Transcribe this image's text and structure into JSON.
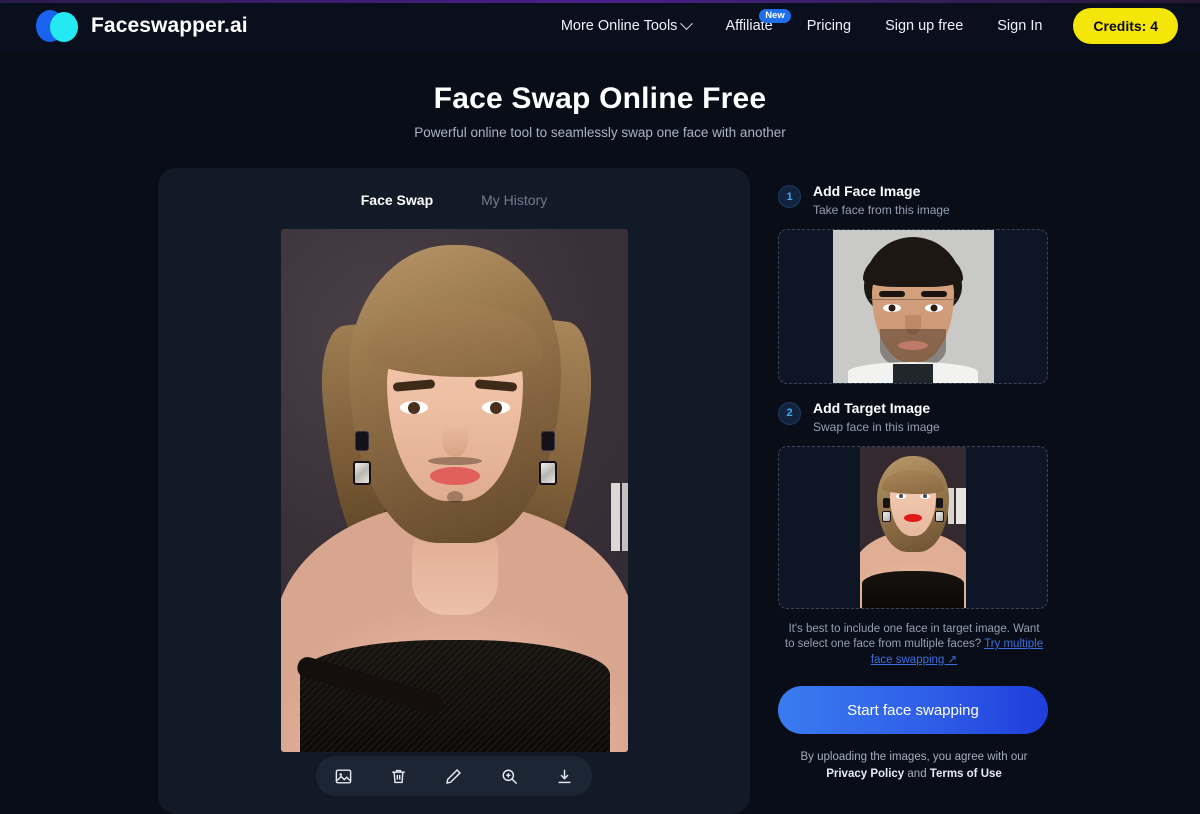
{
  "header": {
    "brand_name": "Faceswapper.ai",
    "nav": [
      {
        "label": "More Online Tools",
        "has_chevron": true,
        "badge": null
      },
      {
        "label": "Affiliate",
        "has_chevron": false,
        "badge": "New"
      },
      {
        "label": "Pricing",
        "has_chevron": false,
        "badge": null
      },
      {
        "label": "Sign up free",
        "has_chevron": false,
        "badge": null
      },
      {
        "label": "Sign In",
        "has_chevron": false,
        "badge": null
      }
    ],
    "credits_label": "Credits: 4",
    "credits_color": "#f5e609"
  },
  "hero": {
    "title": "Face Swap Online Free",
    "subtitle": "Powerful online tool to seamlessly swap one face with another"
  },
  "card": {
    "tabs": [
      {
        "label": "Face Swap",
        "active": true
      },
      {
        "label": "My History",
        "active": false
      }
    ],
    "toolbar": [
      {
        "icon": "image-icon",
        "label": "Change image"
      },
      {
        "icon": "trash-icon",
        "label": "Delete"
      },
      {
        "icon": "pencil-icon",
        "label": "Edit"
      },
      {
        "icon": "zoom-in-icon",
        "label": "Zoom in"
      },
      {
        "icon": "download-icon",
        "label": "Download"
      }
    ]
  },
  "panel": {
    "steps": [
      {
        "number": "1",
        "title": "Add Face Image",
        "subtitle": "Take face from this image"
      },
      {
        "number": "2",
        "title": "Add Target Image",
        "subtitle": "Swap face in this image"
      }
    ],
    "hint_text_before": "It's best to include one face in target image. Want to select one face from multiple faces? ",
    "hint_link": "Try multiple face swapping ↗",
    "cta_label": "Start face swapping",
    "legal_before": "By uploading the images, you agree with our ",
    "legal_privacy": "Privacy Policy",
    "legal_middle": " and ",
    "legal_terms": "Terms of Use",
    "accent_color": "#3b6fe0"
  }
}
